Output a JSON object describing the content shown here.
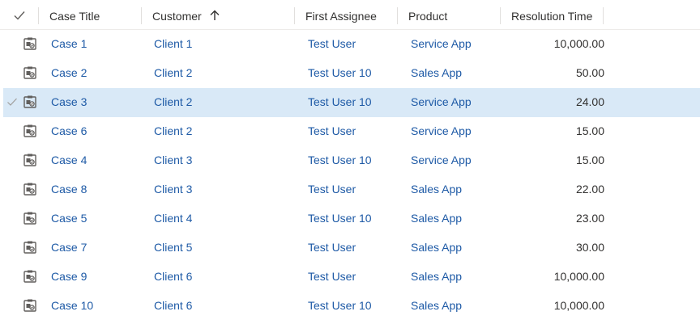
{
  "columns": {
    "case_title": "Case Title",
    "customer": "Customer",
    "first_assignee": "First Assignee",
    "product": "Product",
    "resolution_time": "Resolution Time"
  },
  "sort": {
    "column": "customer",
    "direction": "ascending",
    "icon": "arrow-up-icon"
  },
  "selected_row": 2,
  "rows": [
    {
      "case_title": "Case 1",
      "customer": "Client 1",
      "first_assignee": "Test User",
      "product": "Service App",
      "resolution_time": "10,000.00"
    },
    {
      "case_title": "Case 2",
      "customer": "Client 2",
      "first_assignee": "Test User 10",
      "product": "Sales App",
      "resolution_time": "50.00"
    },
    {
      "case_title": "Case 3",
      "customer": "Client 2",
      "first_assignee": "Test User 10",
      "product": "Service App",
      "resolution_time": "24.00"
    },
    {
      "case_title": "Case 6",
      "customer": "Client 2",
      "first_assignee": "Test User",
      "product": "Service App",
      "resolution_time": "15.00"
    },
    {
      "case_title": "Case 4",
      "customer": "Client 3",
      "first_assignee": "Test User 10",
      "product": "Service App",
      "resolution_time": "15.00"
    },
    {
      "case_title": "Case 8",
      "customer": "Client 3",
      "first_assignee": "Test User",
      "product": "Sales App",
      "resolution_time": "22.00"
    },
    {
      "case_title": "Case 5",
      "customer": "Client 4",
      "first_assignee": "Test User 10",
      "product": "Sales App",
      "resolution_time": "23.00"
    },
    {
      "case_title": "Case 7",
      "customer": "Client 5",
      "first_assignee": "Test User",
      "product": "Sales App",
      "resolution_time": "30.00"
    },
    {
      "case_title": "Case 9",
      "customer": "Client 6",
      "first_assignee": "Test User",
      "product": "Sales App",
      "resolution_time": "10,000.00"
    },
    {
      "case_title": "Case 10",
      "customer": "Client 6",
      "first_assignee": "Test User 10",
      "product": "Sales App",
      "resolution_time": "10,000.00"
    }
  ],
  "colors": {
    "link": "#1e5aa6",
    "selected_row": "#d9e9f7",
    "text": "#323130"
  }
}
